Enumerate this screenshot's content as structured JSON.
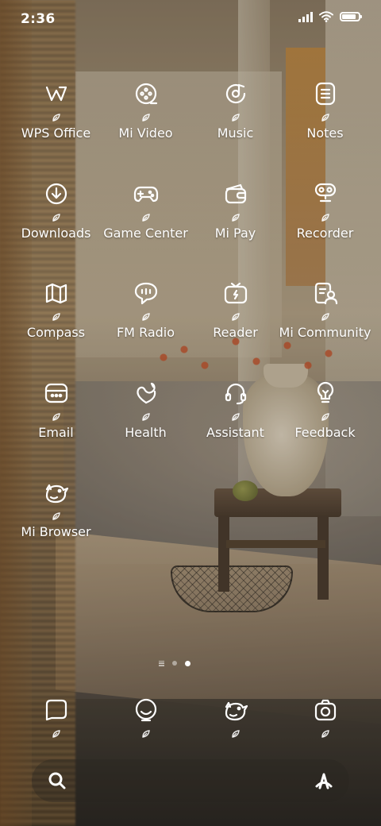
{
  "status_bar": {
    "time": "2:36",
    "battery_level": 0.9
  },
  "apps": [
    {
      "name": "WPS Office",
      "icon": "wps-office-icon"
    },
    {
      "name": "Mi Video",
      "icon": "mi-video-icon"
    },
    {
      "name": "Music",
      "icon": "music-icon"
    },
    {
      "name": "Notes",
      "icon": "notes-icon"
    },
    {
      "name": "Downloads",
      "icon": "downloads-icon"
    },
    {
      "name": "Game Center",
      "icon": "game-center-icon"
    },
    {
      "name": "Mi Pay",
      "icon": "mi-pay-icon"
    },
    {
      "name": "Recorder",
      "icon": "recorder-icon"
    },
    {
      "name": "Compass",
      "icon": "compass-icon"
    },
    {
      "name": "FM Radio",
      "icon": "fm-radio-icon"
    },
    {
      "name": "Reader",
      "icon": "reader-icon"
    },
    {
      "name": "Mi Community",
      "icon": "mi-community-icon"
    },
    {
      "name": "Email",
      "icon": "email-icon"
    },
    {
      "name": "Health",
      "icon": "health-icon"
    },
    {
      "name": "Assistant",
      "icon": "assistant-icon"
    },
    {
      "name": "Feedback",
      "icon": "feedback-icon"
    },
    {
      "name": "Mi Browser",
      "icon": "mi-browser-icon"
    }
  ],
  "page_indicator": {
    "pages": 2,
    "current_page": 2
  },
  "dock": [
    {
      "icon": "messages-icon"
    },
    {
      "icon": "contacts-icon"
    },
    {
      "icon": "browser-icon"
    },
    {
      "icon": "camera-icon"
    }
  ],
  "search_bar": {
    "left_icon": "search-icon",
    "right_icon": "app-vault-icon"
  },
  "colors": {
    "foreground": "#ffffff"
  }
}
